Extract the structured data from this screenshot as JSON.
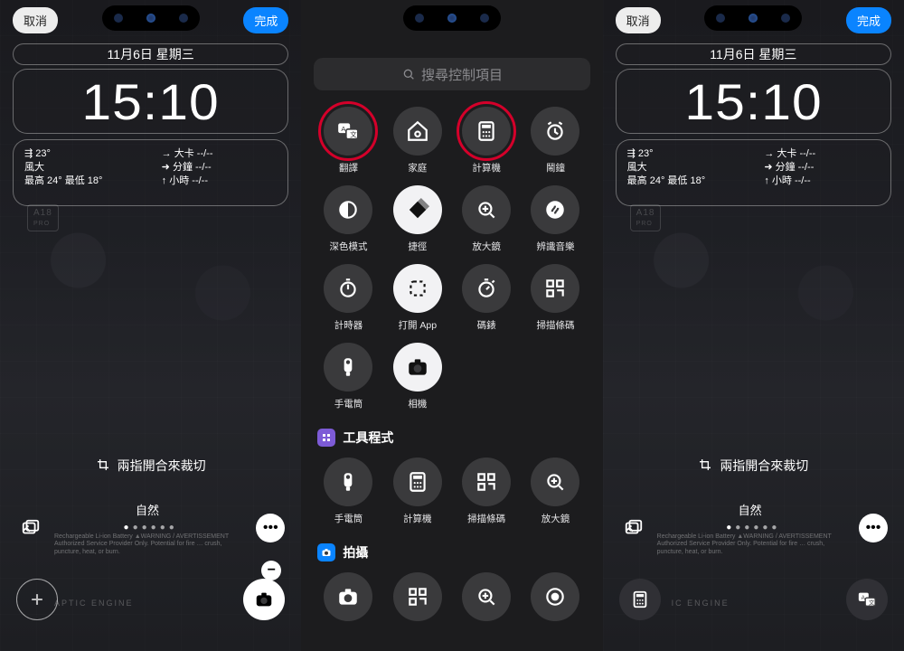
{
  "lockEdit": {
    "cancel": "取消",
    "done": "完成",
    "date": "11月6日 星期三",
    "time": "15:10",
    "widgetLeft": {
      "line1": "⇶ 23°",
      "line2": "風大",
      "line3": "最高 24° 最低 18°"
    },
    "widgetRight": {
      "r1": "→ 大卡    --/--",
      "r2": "➜ 分鐘    --/--",
      "r3": "↑ 小時    --/--"
    },
    "pinchHint": "兩指開合來裁切",
    "styleLabel": "自然",
    "chipLabel": "A18",
    "chipSub": "PRO"
  },
  "picker": {
    "searchPlaceholder": "搜尋控制項目",
    "items": [
      {
        "id": "translate",
        "label": "翻譯",
        "highlight": true
      },
      {
        "id": "home",
        "label": "家庭"
      },
      {
        "id": "calculator",
        "label": "計算機",
        "highlight": true
      },
      {
        "id": "alarm",
        "label": "鬧鐘"
      },
      {
        "id": "darkmode",
        "label": "深色模式"
      },
      {
        "id": "shortcuts",
        "label": "捷徑",
        "lite": true
      },
      {
        "id": "magnifier",
        "label": "放大鏡"
      },
      {
        "id": "shazam",
        "label": "辨識音樂"
      },
      {
        "id": "timer",
        "label": "計時器"
      },
      {
        "id": "openapp",
        "label": "打開 App",
        "lite": true
      },
      {
        "id": "codescan",
        "label": "碼錶"
      },
      {
        "id": "scanqr",
        "label": "掃描條碼"
      },
      {
        "id": "flashlight",
        "label": "手電筒"
      },
      {
        "id": "camera",
        "label": "相機",
        "lite": true
      }
    ],
    "section1": {
      "title": "工具程式",
      "items": [
        {
          "id": "flashlight2",
          "label": "手電筒"
        },
        {
          "id": "calculator2",
          "label": "計算機"
        },
        {
          "id": "scanqr2",
          "label": "掃描條碼"
        },
        {
          "id": "magnifier2",
          "label": "放大鏡"
        }
      ]
    },
    "section2": {
      "title": "拍攝",
      "items": [
        {
          "id": "camera2"
        },
        {
          "id": "scan3"
        },
        {
          "id": "mag3"
        },
        {
          "id": "rec"
        }
      ]
    }
  }
}
